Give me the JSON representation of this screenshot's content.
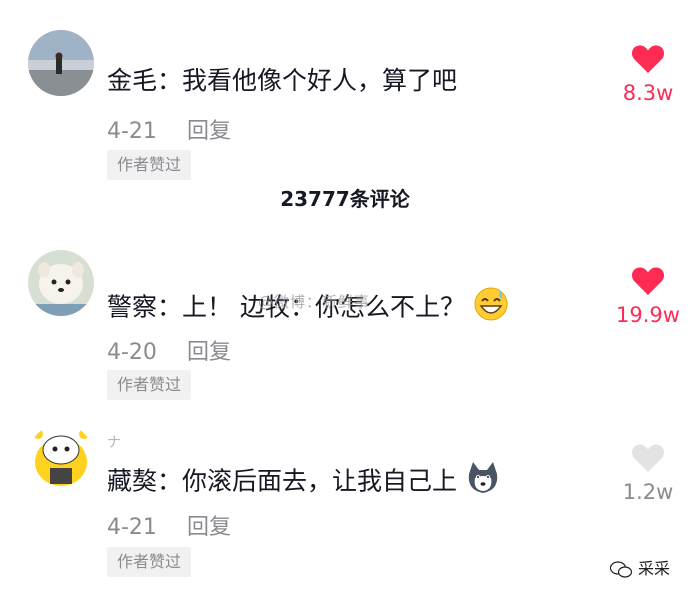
{
  "total_comments": "23777条评论",
  "watermark": "@微博：新鲜事",
  "corner_mark": "采采",
  "comments": [
    {
      "text": "金毛：我看他像个好人，算了吧",
      "date": "4-21",
      "reply_label": "回复",
      "author_liked": "作者赞过",
      "likes": "8.3w",
      "liked": true,
      "avatar": "beach-photo-avatar"
    },
    {
      "text": "警察：上！ 边牧：你怎么不上？",
      "date": "4-20",
      "reply_label": "回复",
      "author_liked": "作者赞过",
      "likes": "19.9w",
      "liked": true,
      "avatar": "samoyed-dog-avatar",
      "emoji": "sweat-smile-emoji"
    },
    {
      "text": "藏獒：你滚后面去，让我自己上",
      "date": "4-21",
      "reply_label": "回复",
      "author_liked": "作者赞过",
      "likes": "1.2w",
      "liked": false,
      "avatar": "cartoon-yellow-avatar",
      "emoji": "husky-face-emoji"
    }
  ],
  "colors": {
    "heart_active": "#fe2c55",
    "heart_inactive": "#e3e3e4",
    "meta_text": "#8a8b91"
  }
}
